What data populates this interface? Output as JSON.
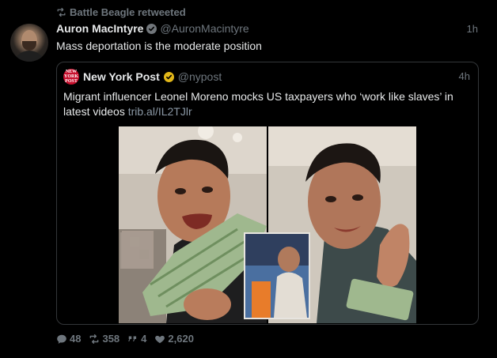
{
  "retweet_line": {
    "text": "Battle Beagle retweeted",
    "icon": "retweet-icon"
  },
  "tweet": {
    "author_name": "Auron MacIntyre",
    "author_handle": "@AuronMacintyre",
    "verified": true,
    "time": "1h",
    "text": "Mass deportation is the moderate position"
  },
  "quoted_tweet": {
    "author_name": "New York Post",
    "author_handle": "@nypost",
    "avatar_text": "NEW YORK POST",
    "verified": true,
    "verified_color": "#e2b719",
    "time": "4h",
    "text": "Migrant influencer Leonel Moreno mocks US taxpayers who ‘work like slaves’ in latest videos",
    "link": "trib.al/IL2TJlr"
  },
  "actions": {
    "replies": "48",
    "retweets": "358",
    "quotes": "4",
    "likes": "2,620"
  },
  "colors": {
    "background": "#000000",
    "text": "#e7e9ea",
    "muted": "#6e767d",
    "border": "#333639",
    "verified_blue": "#71767b",
    "nypost_red": "#c8102e"
  }
}
